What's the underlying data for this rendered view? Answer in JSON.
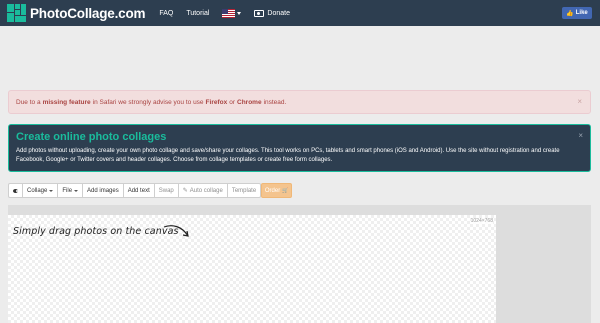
{
  "nav": {
    "brand": "PhotoCollage.com",
    "links": {
      "faq": "FAQ",
      "tutorial": "Tutorial",
      "donate": "Donate"
    },
    "like": "Like",
    "language_flag": "us-flag-icon"
  },
  "alert": {
    "prefix": "Due to a",
    "bold1": "missing feature",
    "middle": "in Safari we strongly advise you to use",
    "bold2": "Firefox",
    "or": "or",
    "bold3": "Chrome",
    "suffix": "instead.",
    "close": "×"
  },
  "info": {
    "title": "Create online photo collages",
    "text": "Add photos without uploading, create your own photo collage and save/share your collages. This tool works on PCs, tablets and smart phones (iOS and Android). Use the site without registration and create Facebook, Google+ or Twitter covers and header collages. Choose from collage templates or create free form collages.",
    "close": "×"
  },
  "toolbar": {
    "collage": "Collage",
    "file": "File",
    "add_images": "Add images",
    "add_text": "Add text",
    "swap": "Swap",
    "auto_collage": "Auto collage",
    "template": "Template",
    "order": "Order"
  },
  "canvas": {
    "size": "1024×768",
    "hint": "Simply drag photos on the canvas"
  },
  "colors": {
    "navbar": "#2d3e50",
    "accent": "#1abc9c",
    "alert_bg": "#f2dede",
    "alert_text": "#a94442",
    "order_btn": "#f4c48e"
  }
}
